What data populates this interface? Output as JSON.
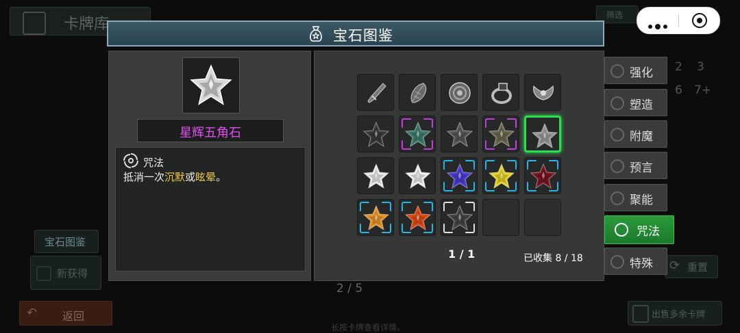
{
  "background": {
    "title": "卡牌库",
    "gem_catalog_button": "宝石图鉴",
    "new_obtained": "新获得",
    "back_button": "返回",
    "page_indicator": "2 / 5",
    "hint": "长按卡牌查看详情。",
    "sell_button": "出售多余卡牌",
    "reset_button": "重置",
    "filter_label": "筛选",
    "cost_numbers": [
      "2",
      "3",
      "6",
      "7+"
    ]
  },
  "modal": {
    "title": "宝石图鉴",
    "title_icon": "money-bag-icon",
    "selected_gem": {
      "name": "星辉五角石",
      "name_color": "#e24ef0",
      "type_icon": "spiral-icon",
      "type": "咒法",
      "desc_parts": [
        "抵消一次",
        "沉默",
        "或",
        "眩晕",
        "。"
      ]
    },
    "grid": [
      {
        "icon": "dagger-icon",
        "frame": "none",
        "color": "#888888"
      },
      {
        "icon": "leaf-icon",
        "frame": "none",
        "color": "#888888"
      },
      {
        "icon": "shield-icon",
        "frame": "none",
        "color": "#888888"
      },
      {
        "icon": "ring-icon",
        "frame": "none",
        "color": "#888888"
      },
      {
        "icon": "wings-icon",
        "frame": "none",
        "color": "#888888"
      },
      {
        "icon": "star-gem-icon",
        "frame": "none",
        "color": "#3a3a3a"
      },
      {
        "icon": "star-gem-icon",
        "frame": "purple",
        "color": "#3f7a6e"
      },
      {
        "icon": "star-gem-icon",
        "frame": "none",
        "color": "#555555"
      },
      {
        "icon": "star-gem-icon",
        "frame": "purple",
        "color": "#6b6650"
      },
      {
        "icon": "star-gem-icon",
        "frame": "selected",
        "color": "#9a9a9a"
      },
      {
        "icon": "star-gem-icon",
        "frame": "none",
        "color": "#e8e8e8"
      },
      {
        "icon": "star-gem-icon",
        "frame": "none",
        "color": "#ededed"
      },
      {
        "icon": "star-gem-icon",
        "frame": "blue",
        "color": "#4a3ad0"
      },
      {
        "icon": "star-gem-icon",
        "frame": "blue",
        "color": "#e6d42a"
      },
      {
        "icon": "star-gem-icon",
        "frame": "blue",
        "color": "#7a1420"
      },
      {
        "icon": "star-gem-icon",
        "frame": "blue",
        "color": "#e8952a"
      },
      {
        "icon": "star-gem-icon",
        "frame": "blue",
        "color": "#e04a14"
      },
      {
        "icon": "star-gem-icon",
        "frame": "white",
        "color": "#444444"
      },
      {
        "icon": "",
        "frame": "empty",
        "color": ""
      },
      {
        "icon": "",
        "frame": "empty",
        "color": ""
      }
    ],
    "page": "1 / 1",
    "collected": "已收集 8 / 18"
  },
  "categories": [
    {
      "label": "强化",
      "icon": "plus-icon",
      "active": false
    },
    {
      "label": "塑造",
      "icon": "gear-icon",
      "active": false
    },
    {
      "label": "附魔",
      "icon": "wave-icon",
      "active": false
    },
    {
      "label": "预言",
      "icon": "eye-icon",
      "active": false
    },
    {
      "label": "聚能",
      "icon": "burst-icon",
      "active": false
    },
    {
      "label": "咒法",
      "icon": "spiral-icon",
      "active": true
    },
    {
      "label": "特殊",
      "icon": "star-icon",
      "active": false
    }
  ],
  "colors": {
    "accent_green": "#27e04b",
    "header_bg": "#3c5966"
  }
}
